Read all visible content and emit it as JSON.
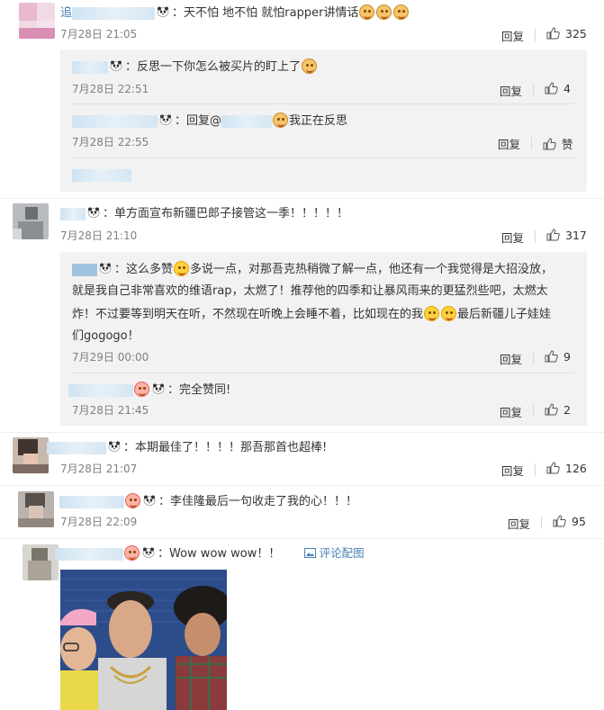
{
  "comments": [
    {
      "prefix": "追",
      "text": "：天不怕 地不怕 就怕rapper讲情话",
      "time": "7月28日 21:05",
      "reply_label": "回复",
      "likes": "325",
      "subs": [
        {
          "text": "：反思一下你怎么被买片的盯上了",
          "time": "7月28日 22:51",
          "reply_label": "回复",
          "likes": "4"
        },
        {
          "text_a": "：回复@",
          "text_b": "我正在反思",
          "time": "7月28日 22:55",
          "reply_label": "回复",
          "likes": "赞"
        }
      ]
    },
    {
      "text": "：单方面宣布新疆巴郎子接管这一季！！！！！",
      "time": "7月28日 21:10",
      "reply_label": "回复",
      "likes": "317",
      "subs": [
        {
          "line1a": "：这么多赞",
          "line1b": "多说一点，对那吾克热稍微了解一点，他还有一个我觉得是大招没放，",
          "line2": "就是我自己非常喜欢的维语rap，太燃了！推荐他的四季和让暴风雨来的更猛烈些吧，太燃太",
          "line3a": "炸！不过要等到明天在听，不然现在听晚上会睡不着，比如现在的我",
          "line3b": "最后新疆儿子娃娃",
          "line4": "们gogogo！",
          "time": "7月29日 00:00",
          "reply_label": "回复",
          "likes": "9"
        },
        {
          "text": "：完全赞同!",
          "time": "7月28日 21:45",
          "reply_label": "回复",
          "likes": "2"
        }
      ]
    },
    {
      "text": "：本期最佳了！！！！那吾那首也超棒!",
      "time": "7月28日 21:07",
      "reply_label": "回复",
      "likes": "126"
    },
    {
      "text": "：李佳隆最后一句收走了我的心！！！",
      "time": "7月28日 22:09",
      "reply_label": "回复",
      "likes": "95"
    },
    {
      "text": "：Wow wow wow！！",
      "pic_link": "评论配图"
    }
  ],
  "colors": {
    "link": "#4a7fb5",
    "sub_bg": "#f2f2f2",
    "muted": "#808080"
  },
  "icons": [
    "thumb-up-icon",
    "panda-emoji-icon",
    "laugh-emoji-icon",
    "cat-emoji-icon",
    "heart-eyes-emoji-icon",
    "image-icon"
  ]
}
